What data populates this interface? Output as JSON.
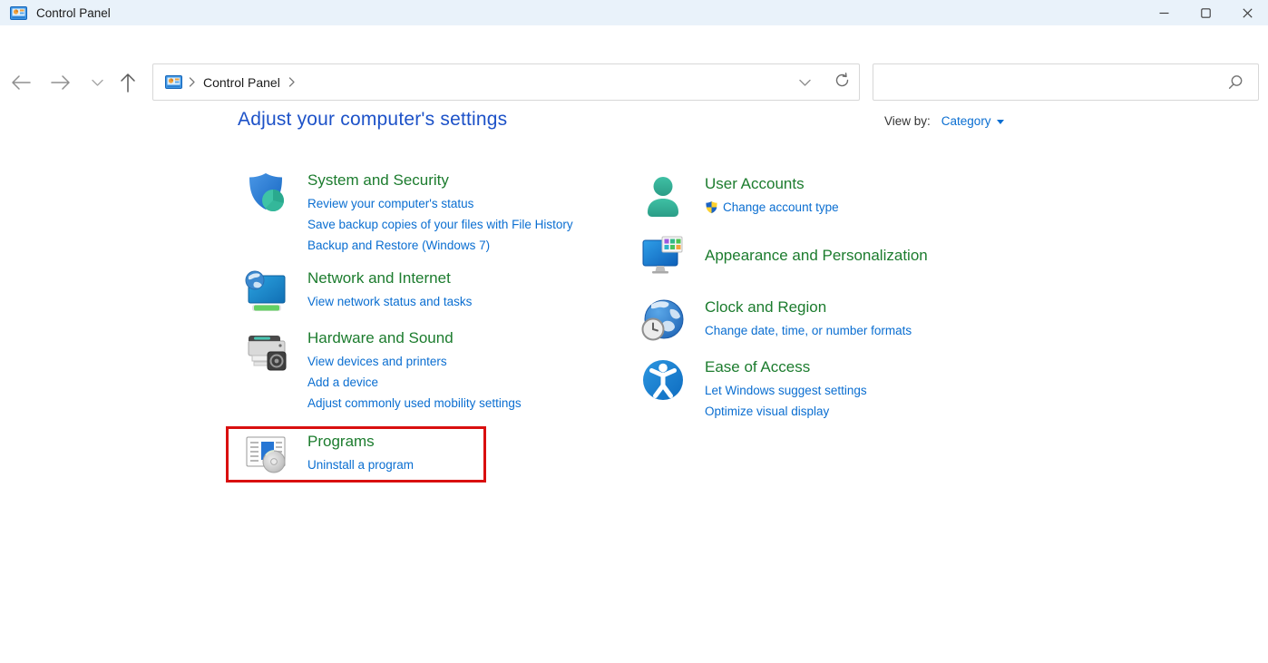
{
  "window": {
    "title": "Control Panel",
    "controls": {
      "minimize": "minimize",
      "maximize": "maximize",
      "close": "close"
    }
  },
  "navbar": {
    "back": "back",
    "forward": "forward",
    "recent_pages": "recent-pages-dropdown",
    "up": "up",
    "breadcrumb_root_icon": "control-panel-icon",
    "breadcrumb_root": "Control Panel",
    "address_dropdown": "address-dropdown",
    "refresh": "refresh",
    "search": {
      "value": "",
      "placeholder": "",
      "icon": "search-icon"
    }
  },
  "header": {
    "title": "Adjust your computer's settings",
    "view_by_label": "View by:",
    "view_by_value": "Category"
  },
  "categories": {
    "left": [
      {
        "id": "system-security",
        "icon": "shield-icon",
        "title": "System and Security",
        "links": [
          "Review your computer's status",
          "Save backup copies of your files with File History",
          "Backup and Restore (Windows 7)"
        ]
      },
      {
        "id": "network-internet",
        "icon": "network-monitor-icon",
        "title": "Network and Internet",
        "links": [
          "View network status and tasks"
        ]
      },
      {
        "id": "hardware-sound",
        "icon": "printer-icon",
        "title": "Hardware and Sound",
        "links": [
          "View devices and printers",
          "Add a device",
          "Adjust commonly used mobility settings"
        ]
      },
      {
        "id": "programs",
        "icon": "programs-icon",
        "title": "Programs",
        "links": [
          "Uninstall a program"
        ],
        "highlighted": true
      }
    ],
    "right": [
      {
        "id": "user-accounts",
        "icon": "user-icon",
        "title": "User Accounts",
        "links": [
          "Change account type"
        ],
        "link_shield": true
      },
      {
        "id": "appearance-personalization",
        "icon": "monitor-palette-icon",
        "title": "Appearance and Personalization",
        "links": []
      },
      {
        "id": "clock-region",
        "icon": "globe-clock-icon",
        "title": "Clock and Region",
        "links": [
          "Change date, time, or number formats"
        ]
      },
      {
        "id": "ease-of-access",
        "icon": "accessibility-icon",
        "title": "Ease of Access",
        "links": [
          "Let Windows suggest settings",
          "Optimize visual display"
        ]
      }
    ]
  },
  "colors": {
    "titlebar_bg": "#e9f2fa",
    "category_title_green": "#1c7c2e",
    "link_blue": "#0a6ed1",
    "page_title_blue": "#1d52c8",
    "highlight_red": "#d90f0f"
  }
}
